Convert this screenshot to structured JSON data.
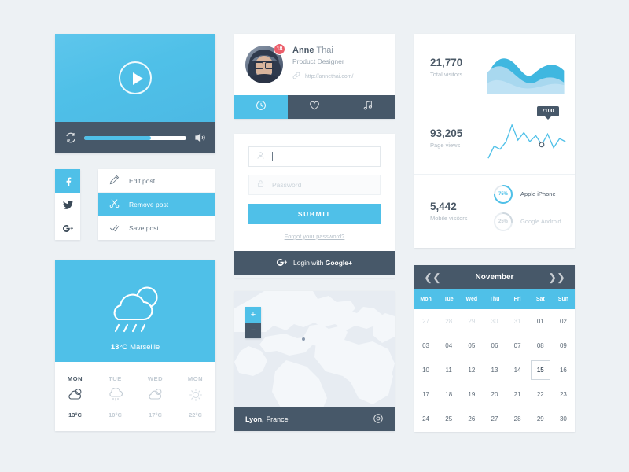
{
  "theme": {
    "primary": "#4fc0e8",
    "dark": "#475869",
    "background": "#edf1f4",
    "card": "#ffffff",
    "danger": "#ec5f6b",
    "text": "#4a5866",
    "muted": "#b0bac3"
  },
  "video_player": {
    "name": "video-player",
    "play_icon": "play-icon",
    "loop_icon": "loop-icon",
    "volume_icon": "volume-icon",
    "progress_percent": 65
  },
  "social_rail": {
    "items": [
      {
        "label": "Facebook",
        "icon": "facebook-icon",
        "active": true
      },
      {
        "label": "Twitter",
        "icon": "twitter-icon",
        "active": false
      },
      {
        "label": "Google Plus",
        "icon": "google-plus-icon",
        "active": false
      }
    ]
  },
  "post_menu": {
    "items": [
      {
        "label": "Edit post",
        "icon": "pencil-icon",
        "active": false
      },
      {
        "label": "Remove post",
        "icon": "scissors-icon",
        "active": true
      },
      {
        "label": "Save post",
        "icon": "check-icon",
        "active": false
      }
    ]
  },
  "weather": {
    "icon": "rain-cloud-sun-icon",
    "temperature": "13°C",
    "city": "Marseille",
    "forecast": [
      {
        "day": "MON",
        "icon": "sun-cloud-icon",
        "temp": "13°C",
        "today": true
      },
      {
        "day": "TUE",
        "icon": "rain-cloud-icon",
        "temp": "10°C",
        "today": false
      },
      {
        "day": "WED",
        "icon": "sun-cloud-icon",
        "temp": "17°C",
        "today": false
      },
      {
        "day": "MON",
        "icon": "sun-icon",
        "temp": "22°C",
        "today": false
      }
    ]
  },
  "profile": {
    "avatar_alt": "avatar",
    "badge_count": "18",
    "first_name": "Anne",
    "last_name": "Thai",
    "role": "Product Designer",
    "link_icon": "link-icon",
    "link": "http://annethai.com/",
    "tabs": [
      {
        "icon": "clock-icon",
        "label": "Recent",
        "active": true
      },
      {
        "icon": "heart-icon",
        "label": "Likes",
        "active": false
      },
      {
        "icon": "music-note-icon",
        "label": "Music",
        "active": false
      }
    ]
  },
  "login": {
    "username_icon": "user-icon",
    "username_value": "",
    "username_placeholder": "",
    "password_icon": "lock-icon",
    "password_value": "",
    "password_placeholder": "Password",
    "submit_label": "SUBMIT",
    "forgot_label": "Forgot your password?",
    "google_icon": "google-plus-icon",
    "google_label_prefix": "Login with",
    "google_label_brand": "Google+"
  },
  "map": {
    "zoom_in_label": "+",
    "zoom_out_label": "−",
    "pin_icon": "location-pin-icon",
    "city": "Lyon,",
    "country": "France"
  },
  "stats": {
    "rows": [
      {
        "value": "21,770",
        "label": "Total visitors",
        "viz": "area-chart"
      },
      {
        "value": "93,205",
        "label": "Page views",
        "viz": "line-chart",
        "tooltip": "7100"
      },
      {
        "value": "5,442",
        "label": "Mobile visitors",
        "viz": "donuts"
      }
    ],
    "donuts": [
      {
        "percent": "75%",
        "value": 75,
        "label": "Apple iPhone",
        "active": true
      },
      {
        "percent": "25%",
        "value": 25,
        "label": "Google Android",
        "active": false
      }
    ]
  },
  "calendar": {
    "prev_icon": "chevron-left-icon",
    "next_icon": "chevron-right-icon",
    "month": "November",
    "dow": [
      "Mon",
      "Tue",
      "Wed",
      "Thu",
      "Fri",
      "Sat",
      "Sun"
    ],
    "selected": "15",
    "weeks": [
      [
        {
          "d": "27",
          "m": true
        },
        {
          "d": "28",
          "m": true
        },
        {
          "d": "29",
          "m": true
        },
        {
          "d": "30",
          "m": true
        },
        {
          "d": "31",
          "m": true
        },
        {
          "d": "01",
          "m": false
        },
        {
          "d": "02",
          "m": false
        }
      ],
      [
        {
          "d": "03",
          "m": false
        },
        {
          "d": "04",
          "m": false
        },
        {
          "d": "05",
          "m": false
        },
        {
          "d": "06",
          "m": false
        },
        {
          "d": "07",
          "m": false
        },
        {
          "d": "08",
          "m": false
        },
        {
          "d": "09",
          "m": false
        }
      ],
      [
        {
          "d": "10",
          "m": false
        },
        {
          "d": "11",
          "m": false
        },
        {
          "d": "12",
          "m": false
        },
        {
          "d": "13",
          "m": false
        },
        {
          "d": "14",
          "m": false
        },
        {
          "d": "15",
          "m": false,
          "sel": true
        },
        {
          "d": "16",
          "m": false
        }
      ],
      [
        {
          "d": "17",
          "m": false
        },
        {
          "d": "18",
          "m": false
        },
        {
          "d": "19",
          "m": false
        },
        {
          "d": "20",
          "m": false
        },
        {
          "d": "21",
          "m": false
        },
        {
          "d": "22",
          "m": false
        },
        {
          "d": "23",
          "m": false
        }
      ],
      [
        {
          "d": "24",
          "m": false
        },
        {
          "d": "25",
          "m": false
        },
        {
          "d": "26",
          "m": false
        },
        {
          "d": "27",
          "m": false
        },
        {
          "d": "28",
          "m": false
        },
        {
          "d": "29",
          "m": false
        },
        {
          "d": "30",
          "m": false
        }
      ]
    ]
  },
  "chart_data": [
    {
      "type": "area",
      "title": "Total visitors",
      "value": 21770,
      "x": [
        0,
        1,
        2,
        3,
        4,
        5,
        6,
        7,
        8
      ],
      "series": [
        {
          "name": "back-wave",
          "values": [
            40,
            72,
            86,
            74,
            46,
            62,
            80,
            58,
            34
          ]
        },
        {
          "name": "front-wave",
          "values": [
            52,
            78,
            70,
            52,
            40,
            54,
            66,
            48,
            30
          ]
        }
      ],
      "grid": false,
      "legend": "none"
    },
    {
      "type": "line",
      "title": "Page views",
      "value": 93205,
      "x": [
        0,
        1,
        2,
        3,
        4,
        5,
        6,
        7,
        8,
        9,
        10,
        11,
        12,
        13
      ],
      "values": [
        10,
        34,
        30,
        46,
        92,
        58,
        74,
        50,
        68,
        44,
        70,
        30,
        62,
        56
      ],
      "annotation": {
        "label": "7100",
        "x": 8,
        "y": 68
      },
      "grid": false,
      "legend": "none"
    },
    {
      "type": "pie",
      "title": "Mobile visitors",
      "value": 5442,
      "labels": [
        "Apple iPhone",
        "Google Android"
      ],
      "values": [
        75,
        25
      ],
      "legend": "right"
    }
  ]
}
